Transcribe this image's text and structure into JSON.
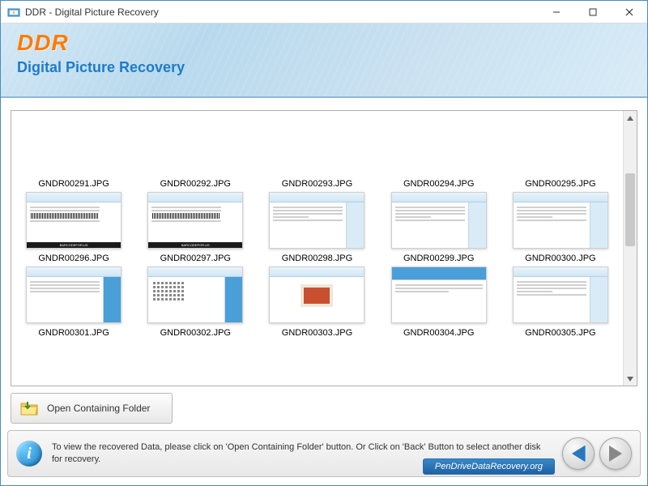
{
  "window": {
    "title": "DDR - Digital Picture Recovery"
  },
  "header": {
    "logo": "DDR",
    "subtitle": "Digital Picture Recovery"
  },
  "thumbnails": [
    {
      "filename": "GNDR00291.JPG",
      "hasImage": false
    },
    {
      "filename": "GNDR00292.JPG",
      "hasImage": false
    },
    {
      "filename": "GNDR00293.JPG",
      "hasImage": false
    },
    {
      "filename": "GNDR00294.JPG",
      "hasImage": false
    },
    {
      "filename": "GNDR00295.JPG",
      "hasImage": false
    },
    {
      "filename": "GNDR00296.JPG",
      "hasImage": true,
      "style": "barcode"
    },
    {
      "filename": "GNDR00297.JPG",
      "hasImage": true,
      "style": "barcode"
    },
    {
      "filename": "GNDR00298.JPG",
      "hasImage": true,
      "style": "form"
    },
    {
      "filename": "GNDR00299.JPG",
      "hasImage": true,
      "style": "form"
    },
    {
      "filename": "GNDR00300.JPG",
      "hasImage": true,
      "style": "form"
    },
    {
      "filename": "GNDR00301.JPG",
      "hasImage": true,
      "style": "form-blue"
    },
    {
      "filename": "GNDR00302.JPG",
      "hasImage": true,
      "style": "dots"
    },
    {
      "filename": "GNDR00303.JPG",
      "hasImage": true,
      "style": "photo"
    },
    {
      "filename": "GNDR00304.JPG",
      "hasImage": true,
      "style": "label"
    },
    {
      "filename": "GNDR00305.JPG",
      "hasImage": true,
      "style": "form"
    }
  ],
  "buttons": {
    "openFolder": "Open Containing Folder"
  },
  "footer": {
    "infoText": "To view the recovered Data, please click on 'Open Containing Folder' button. Or Click on 'Back' Button to select another disk for recovery.",
    "watermark": "PenDriveDataRecovery.org"
  }
}
